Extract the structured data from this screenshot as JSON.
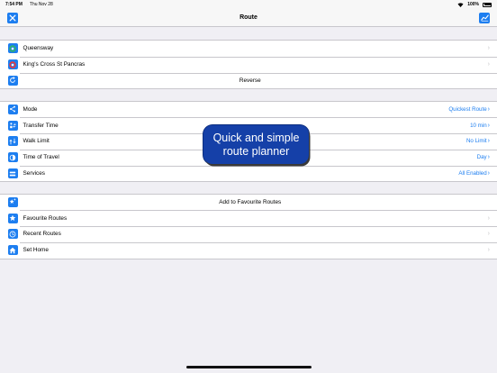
{
  "status_bar": {
    "time": "7:54 PM",
    "date": "Thu Nov 28",
    "battery": "100%"
  },
  "nav": {
    "title": "Route"
  },
  "stations": [
    {
      "label": "Queensway",
      "color": "#2fb36b"
    },
    {
      "label": "King's Cross St Pancras",
      "color": "#e8383d"
    }
  ],
  "reverse_label": "Reverse",
  "options": [
    {
      "label": "Mode",
      "value": "Quickest Route"
    },
    {
      "label": "Transfer Time",
      "value": "10 min"
    },
    {
      "label": "Walk Limit",
      "value": "No Limit"
    },
    {
      "label": "Time of Travel",
      "value": "Day"
    },
    {
      "label": "Services",
      "value": "All Enabled"
    }
  ],
  "favourites": {
    "add_label": "Add to Favourite Routes",
    "items": [
      "Favourite Routes",
      "Recent Routes",
      "Set Home"
    ]
  },
  "promo": {
    "line1": "Quick and simple",
    "line2": "route planner"
  },
  "colors": {
    "accent": "#1d7ef0",
    "promo_bg": "#1540a8"
  }
}
